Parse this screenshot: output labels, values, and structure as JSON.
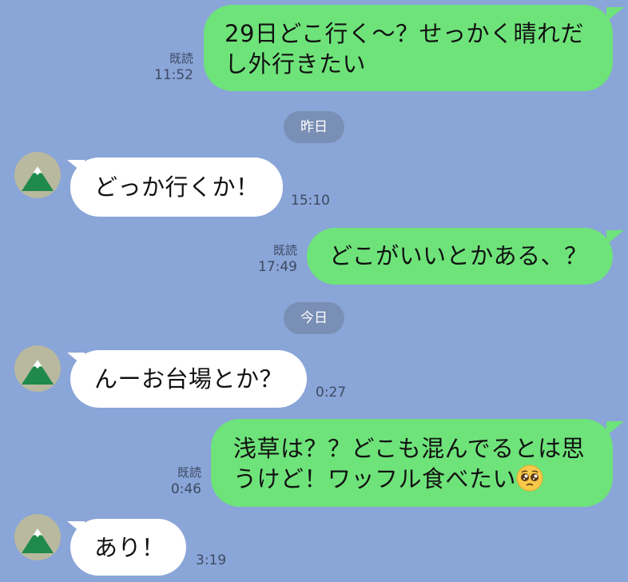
{
  "messages": [
    {
      "dir": "out",
      "text": "29日どこ行く〜？せっかく晴れだし外行きたい",
      "read": "既読",
      "time": "11:52"
    },
    {
      "dir": "date",
      "label": "昨日"
    },
    {
      "dir": "in",
      "text": "どっか行くか！",
      "time": "15:10",
      "avatar_icon": "mountain-icon"
    },
    {
      "dir": "out",
      "text": "どこがいいとかある、？",
      "read": "既読",
      "time": "17:49"
    },
    {
      "dir": "date",
      "label": "今日"
    },
    {
      "dir": "in",
      "text": "んーお台場とか？",
      "time": "0:27",
      "avatar_icon": "mountain-icon"
    },
    {
      "dir": "out",
      "text": "浅草は？？どこも混んでるとは思うけど！ワッフル食べたい",
      "emoji": "pleading-face-icon",
      "read": "既読",
      "time": "0:46"
    },
    {
      "dir": "in",
      "text": "あり！",
      "time": "3:19",
      "avatar_icon": "mountain-icon"
    }
  ],
  "display": {
    "m0_line1": "29日どこ行く〜？せっかく晴れだ",
    "m0_line2": "し外行きたい",
    "m6_line1": "浅草は？？どこも混んでるとは思",
    "m6_line2": "うけど！ワッフル食べたい"
  },
  "colors": {
    "background": "#8aa5d7",
    "outgoing_bubble": "#6ee37a",
    "incoming_bubble": "#ffffff",
    "date_pill": "#7a8fb5",
    "meta_text": "#3d4a63"
  }
}
